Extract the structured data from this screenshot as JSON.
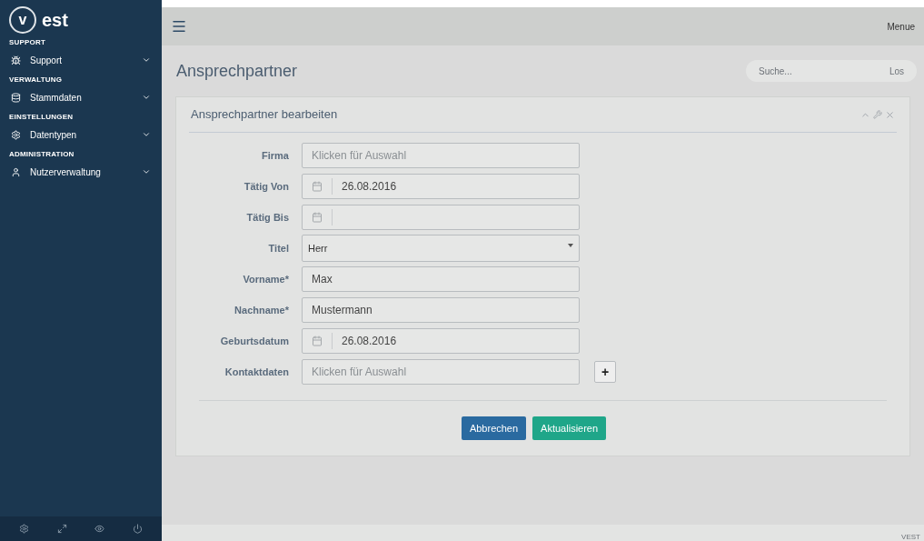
{
  "logo": {
    "mark": "v",
    "text": "est"
  },
  "sidebar": {
    "sections": [
      {
        "heading": "SUPPORT",
        "items": [
          {
            "label": "Support"
          }
        ]
      },
      {
        "heading": "VERWALTUNG",
        "items": [
          {
            "label": "Stammdaten"
          }
        ]
      },
      {
        "heading": "EINSTELLUNGEN",
        "items": [
          {
            "label": "Datentypen"
          }
        ]
      },
      {
        "heading": "ADMINISTRATION",
        "items": [
          {
            "label": "Nutzerverwaltung"
          }
        ]
      }
    ]
  },
  "topbar": {
    "menu": "Menue"
  },
  "page": {
    "title": "Ansprechpartner",
    "search": {
      "placeholder": "Suche...",
      "button": "Los"
    }
  },
  "panel": {
    "title": "Ansprechpartner bearbeiten",
    "fields": [
      {
        "label": "Firma",
        "kind": "text",
        "placeholder": "Klicken für Auswahl"
      },
      {
        "label": "Tätig Von",
        "kind": "date",
        "value": "26.08.2016"
      },
      {
        "label": "Tätig Bis",
        "kind": "date"
      },
      {
        "label": "Titel",
        "kind": "select",
        "value": "Herr"
      },
      {
        "label": "Vorname*",
        "kind": "text",
        "value": "Max"
      },
      {
        "label": "Nachname*",
        "kind": "text",
        "value": "Mustermann"
      },
      {
        "label": "Geburtsdatum",
        "kind": "date",
        "value": "26.08.2016"
      },
      {
        "label": "Kontaktdaten",
        "kind": "text",
        "placeholder": "Klicken für Auswahl",
        "add_button": "+"
      }
    ],
    "buttons": [
      {
        "label": "Abbrechen",
        "kind": "cancel"
      },
      {
        "label": "Aktualisieren",
        "kind": "submit"
      }
    ]
  },
  "footer": {
    "text": "VEST"
  }
}
